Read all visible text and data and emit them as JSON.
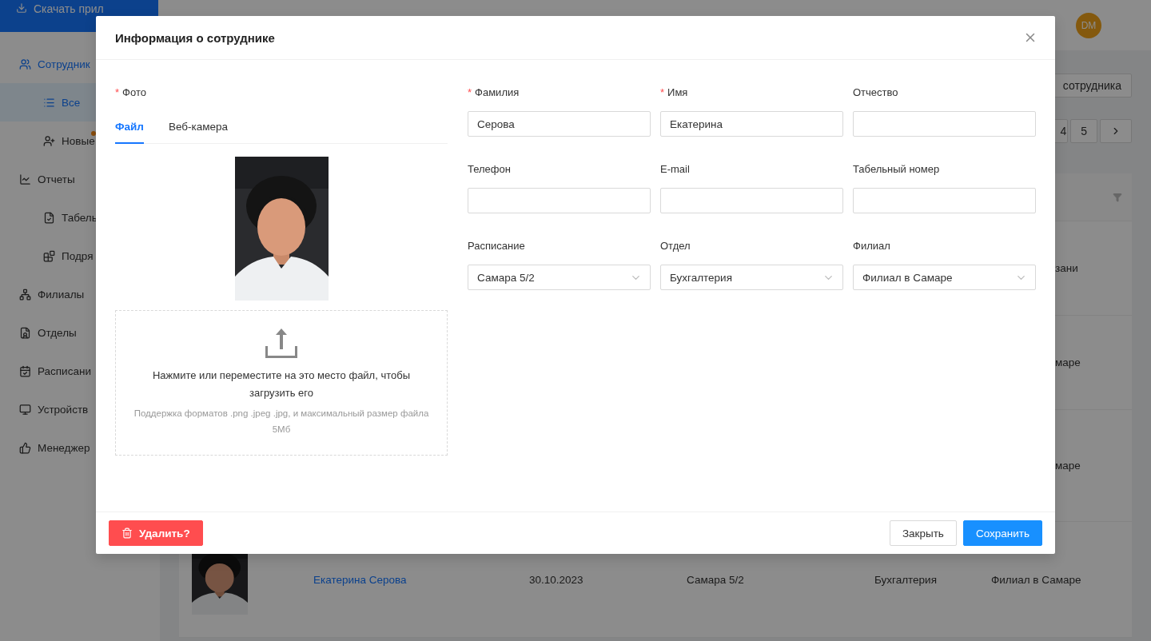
{
  "app_bar": {
    "download_button": "Скачать прил",
    "avatar": "DM"
  },
  "sidebar": {
    "items": [
      {
        "label": "Сотрудник",
        "expanded": true,
        "selected": false,
        "children": [
          {
            "label": "Все",
            "selected": true,
            "dot": false
          },
          {
            "label": "Новые",
            "selected": false,
            "dot": true
          }
        ]
      },
      {
        "label": "Отчеты",
        "expanded": true,
        "selected": false,
        "children": [
          {
            "label": "Табель",
            "selected": false,
            "dot": false
          },
          {
            "label": "Подря",
            "selected": false,
            "dot": false
          }
        ]
      },
      {
        "label": "Филиалы",
        "expanded": false,
        "selected": false
      },
      {
        "label": "Отделы",
        "expanded": false,
        "selected": false
      },
      {
        "label": "Расписани",
        "expanded": false,
        "selected": false
      },
      {
        "label": "Устройств",
        "expanded": false,
        "selected": false
      },
      {
        "label": "Менеджер",
        "expanded": false,
        "selected": false
      }
    ]
  },
  "content": {
    "add_button": "сотрудника",
    "pagination": [
      {
        "label": "4",
        "selected": false
      },
      {
        "label": "5",
        "selected": false
      }
    ],
    "table": {
      "partial_rows": [
        {
          "column_6": "зани"
        },
        {
          "column_6": "маре"
        },
        {
          "column_6": "маре"
        }
      ],
      "rows": [
        {
          "name": "Екатерина Серова",
          "date": "30.10.2023",
          "schedule": "Самара 5/2",
          "department": "Бухгалтерия",
          "branch": "Филиал в Самаре"
        }
      ]
    }
  },
  "modal": {
    "title": "Информация о сотруднике",
    "photo": {
      "label": "Фото",
      "required_mark": "*",
      "tabs": [
        {
          "label": "Файл",
          "selected": true
        },
        {
          "label": "Веб-камера",
          "selected": false
        }
      ],
      "upload": {
        "text": "Нажмите или переместите на это место файл, чтобы загрузить его",
        "hint": "Поддержка форматов .png .jpeg .jpg, и максимальный размер файла 5Мб"
      }
    },
    "fields": [
      {
        "label": "Фамилия",
        "required_mark": "*",
        "kind": "input",
        "value": "Серова"
      },
      {
        "label": "Имя",
        "required_mark": "*",
        "kind": "input",
        "value": "Екатерина"
      },
      {
        "label": "Отчество",
        "kind": "input"
      },
      {
        "label": "Телефон",
        "kind": "input"
      },
      {
        "label": "E-mail",
        "kind": "input"
      },
      {
        "label": "Табельный номер",
        "kind": "input"
      },
      {
        "label": "Расписание",
        "kind": "select",
        "value": "Самара 5/2"
      },
      {
        "label": "Отдел",
        "kind": "select",
        "value": "Бухгалтерия"
      },
      {
        "label": "Филиал",
        "kind": "select",
        "value": "Филиал в Самаре"
      }
    ],
    "footer": {
      "delete_button": "Удалить?",
      "close_button": "Закрыть",
      "save_button": "Сохранить"
    }
  }
}
